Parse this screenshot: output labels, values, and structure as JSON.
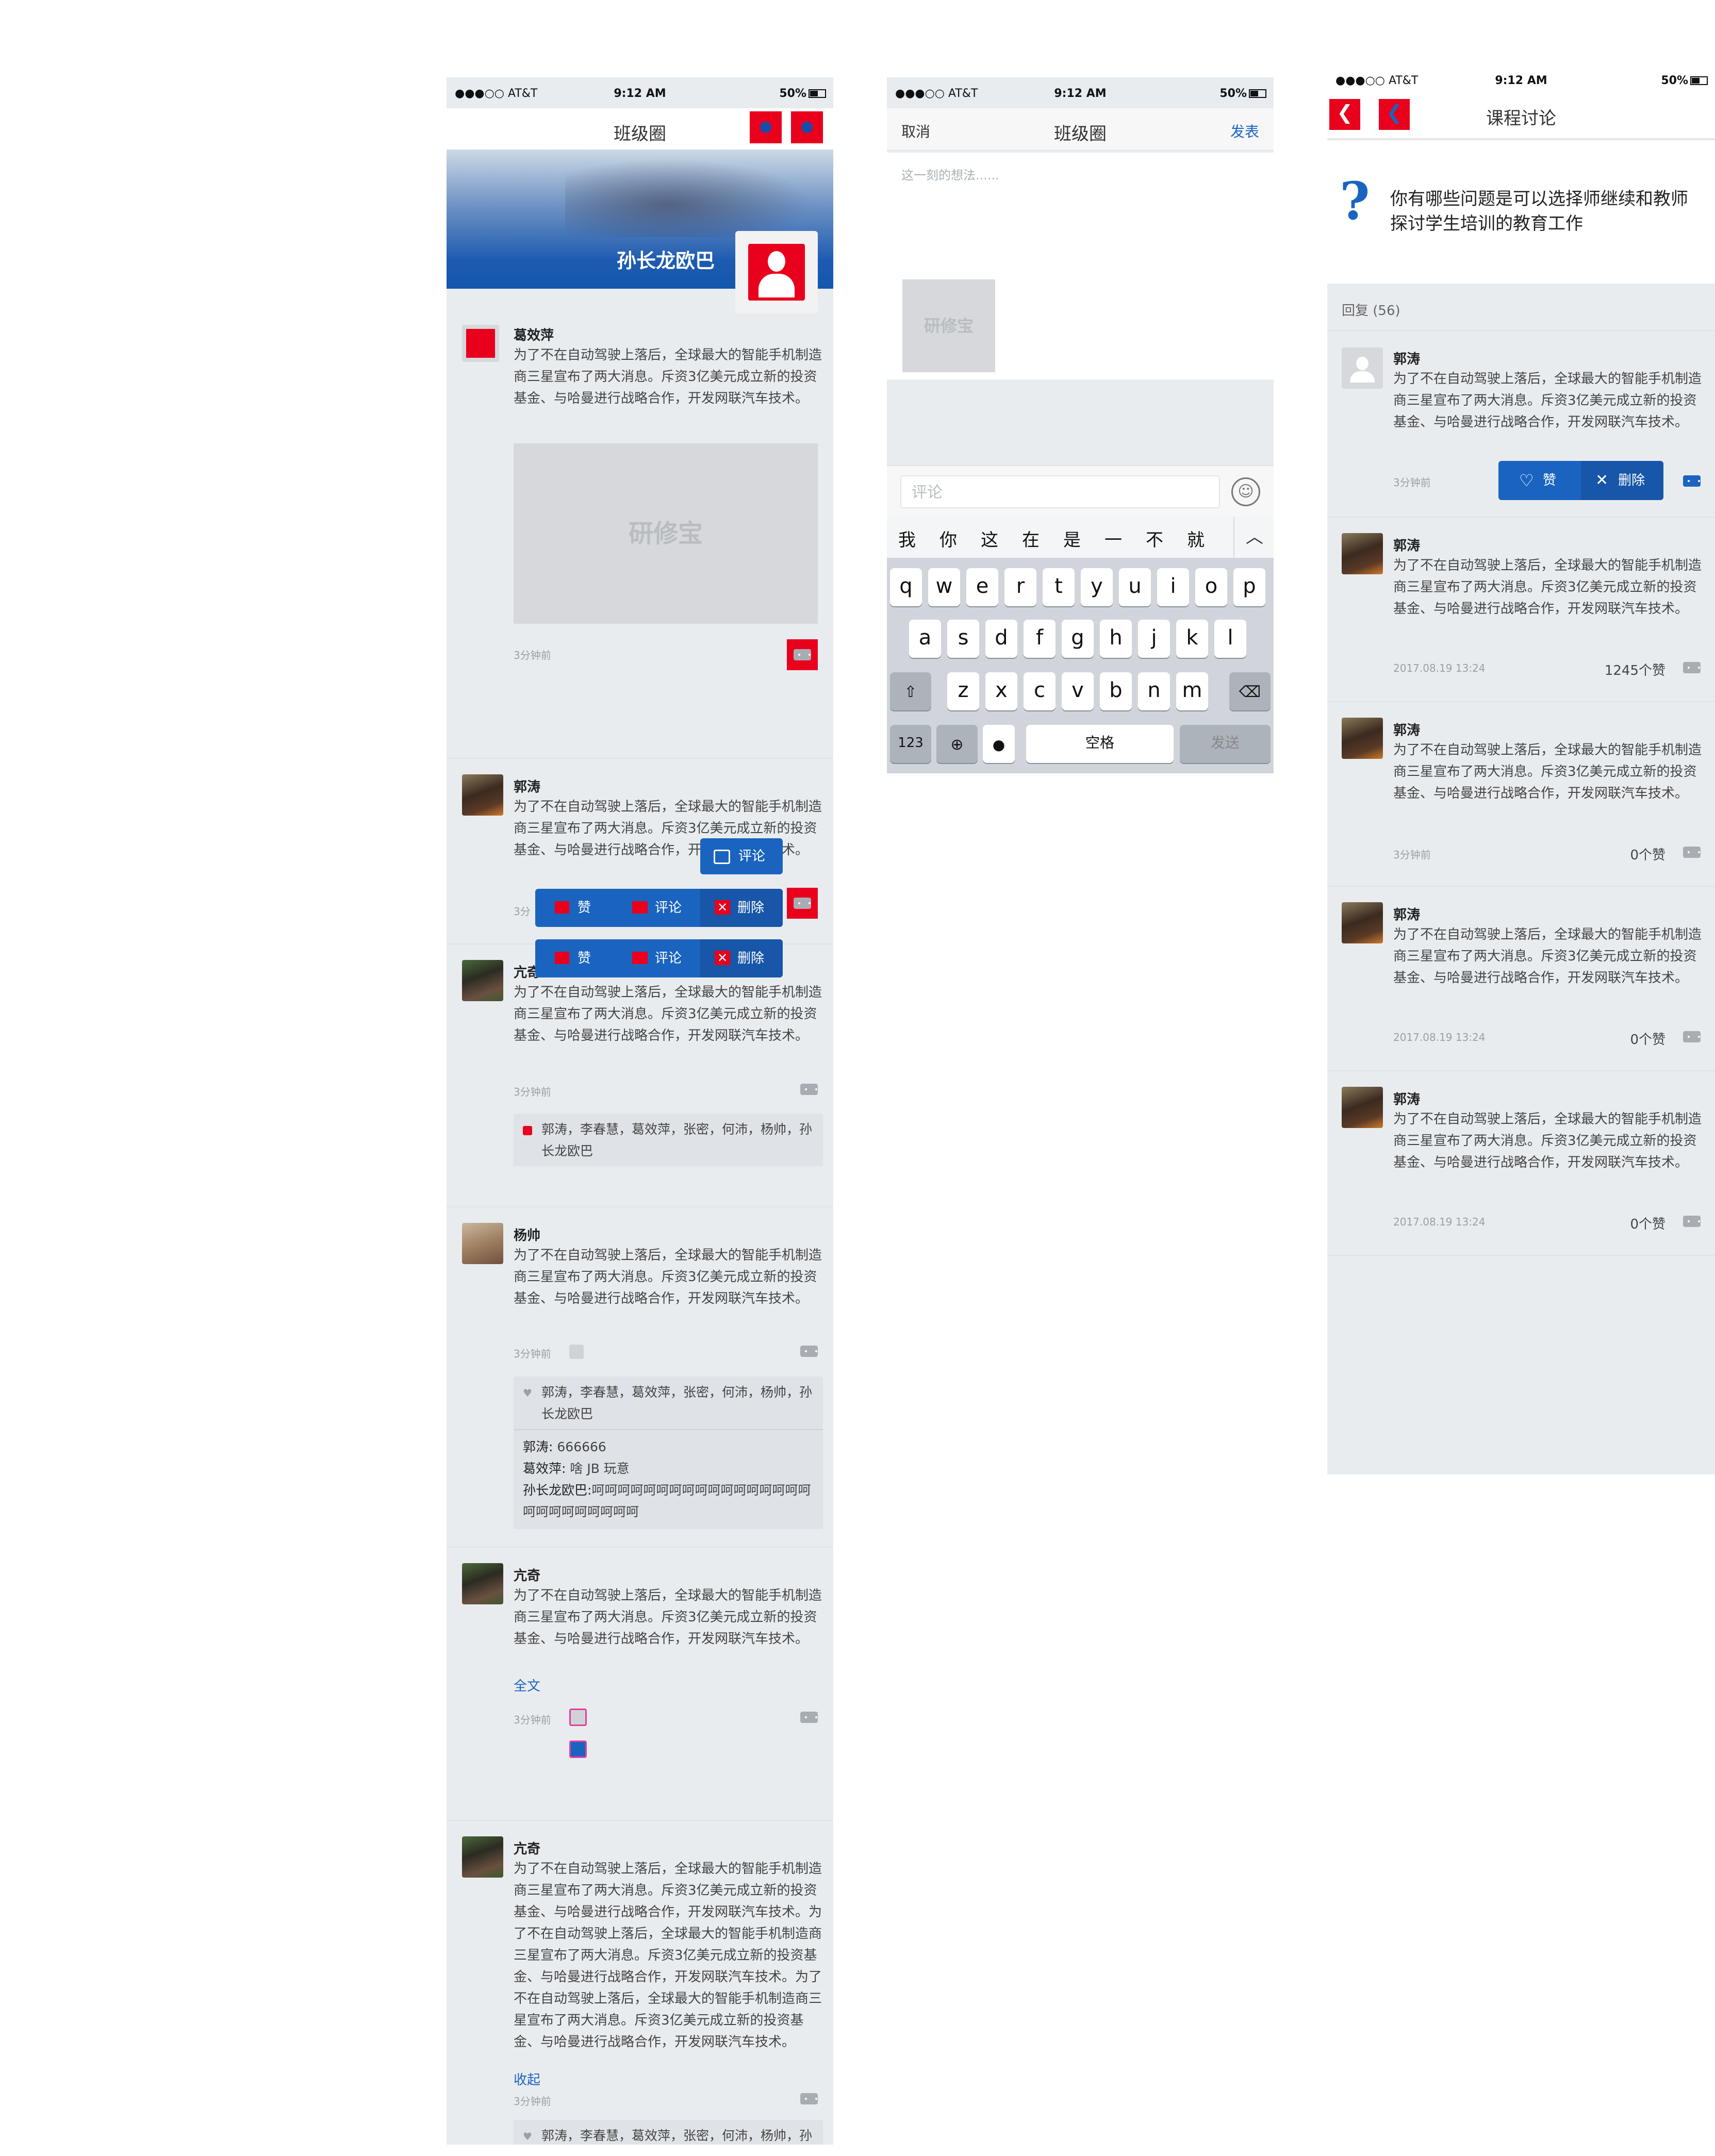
{
  "status": {
    "carrier": "●●●○○ AT&T",
    "time": "9:12 AM",
    "battery": "50%"
  },
  "screen1": {
    "title": "班级圈",
    "banner_name": "孙长龙欧巴",
    "image_placeholder": "研修宝",
    "posts": [
      {
        "user": "葛效萍",
        "text": "为了不在自动驾驶上落后，全球最大的智能手机制造商三星宣布了两大消息。斥资3亿美元成立新的投资基金、与哈曼进行战略合作，开发网联汽车技术。",
        "time": "3分钟前"
      },
      {
        "user": "郭涛",
        "text": "为了不在自动驾驶上落后，全球最大的智能手机制造商三星宣布了两大消息。斥资3亿美元成立新的投资基金、与哈曼进行战略合作，开发网联汽车技术。",
        "time": "3分"
      },
      {
        "user": "亢奇",
        "text": "为了不在自动驾驶上落后，全球最大的智能手机制造商三星宣布了两大消息。斥资3亿美元成立新的投资基金、与哈曼进行战略合作，开发网联汽车技术。",
        "time": "3分钟前",
        "likes": "郭涛，李春慧，葛效萍，张密，何沛，杨帅，孙长龙欧巴"
      },
      {
        "user": "杨帅",
        "text": "为了不在自动驾驶上落后，全球最大的智能手机制造商三星宣布了两大消息。斥资3亿美元成立新的投资基金、与哈曼进行战略合作，开发网联汽车技术。",
        "time": "3分钟前",
        "likes": "郭涛，李春慧，葛效萍，张密，何沛，杨帅，孙长龙欧巴",
        "comments": [
          {
            "who": "郭涛:",
            "text": "666666"
          },
          {
            "who": "葛效萍:",
            "text": "啥 JB 玩意"
          },
          {
            "who": "孙长龙欧巴:",
            "text": "呵呵呵呵呵呵呵呵呵呵呵呵呵呵呵呵呵呵呵呵呵呵呵呵呵呵"
          }
        ]
      },
      {
        "user": "亢奇",
        "text": "为了不在自动驾驶上落后，全球最大的智能手机制造商三星宣布了两大消息。斥资3亿美元成立新的投资基金、与哈曼进行战略合作，开发网联汽车技术。",
        "time": "3分钟前",
        "toggle": "全文"
      },
      {
        "user": "亢奇",
        "text": "为了不在自动驾驶上落后，全球最大的智能手机制造商三星宣布了两大消息。斥资3亿美元成立新的投资基金、与哈曼进行战略合作，开发网联汽车技术。为了不在自动驾驶上落后，全球最大的智能手机制造商三星宣布了两大消息。斥资3亿美元成立新的投资基金、与哈曼进行战略合作，开发网联汽车技术。为了不在自动驾驶上落后，全球最大的智能手机制造商三星宣布了两大消息。斥资3亿美元成立新的投资基金、与哈曼进行战略合作，开发网联汽车技术。",
        "time": "3分钟前",
        "toggle": "收起",
        "likes": "郭涛，李春慧，葛效萍，张密，何沛，杨帅，孙长龙欧巴"
      }
    ],
    "popup_comment": "评论",
    "actions": {
      "like": "赞",
      "comment": "评论",
      "delete": "删除"
    }
  },
  "screen2": {
    "cancel": "取消",
    "title": "班级圈",
    "publish": "发表",
    "placeholder": "这一刻的想法......",
    "image_placeholder": "研修宝",
    "comment_placeholder": "评论",
    "candidates": [
      "我",
      "你",
      "这",
      "在",
      "是",
      "一",
      "不",
      "就"
    ],
    "row1": [
      "q",
      "w",
      "e",
      "r",
      "t",
      "y",
      "u",
      "i",
      "o",
      "p"
    ],
    "row2": [
      "a",
      "s",
      "d",
      "f",
      "g",
      "h",
      "j",
      "k",
      "l"
    ],
    "row3": [
      "z",
      "x",
      "c",
      "v",
      "b",
      "n",
      "m"
    ],
    "num_key": "123",
    "space_key": "空格",
    "send_key": "发送"
  },
  "screen3": {
    "title": "课程讨论",
    "question": "你有哪些问题是可以选择师继续和教师探讨学生培训的教育工作",
    "reply_count": "回复 (56)",
    "actions": {
      "like": "赞",
      "delete": "删除"
    },
    "replies": [
      {
        "user": "郭涛",
        "text": "为了不在自动驾驶上落后，全球最大的智能手机制造商三星宣布了两大消息。斥资3亿美元成立新的投资基金、与哈曼进行战略合作，开发网联汽车技术。",
        "time": "3分钟前",
        "likes": ""
      },
      {
        "user": "郭涛",
        "text": "为了不在自动驾驶上落后，全球最大的智能手机制造商三星宣布了两大消息。斥资3亿美元成立新的投资基金、与哈曼进行战略合作，开发网联汽车技术。",
        "time": "2017.08.19 13:24",
        "likes": "1245个赞"
      },
      {
        "user": "郭涛",
        "text": "为了不在自动驾驶上落后，全球最大的智能手机制造商三星宣布了两大消息。斥资3亿美元成立新的投资基金、与哈曼进行战略合作，开发网联汽车技术。",
        "time": "3分钟前",
        "likes": "0个赞"
      },
      {
        "user": "郭涛",
        "text": "为了不在自动驾驶上落后，全球最大的智能手机制造商三星宣布了两大消息。斥资3亿美元成立新的投资基金、与哈曼进行战略合作，开发网联汽车技术。",
        "time": "2017.08.19 13:24",
        "likes": "0个赞"
      },
      {
        "user": "郭涛",
        "text": "为了不在自动驾驶上落后，全球最大的智能手机制造商三星宣布了两大消息。斥资3亿美元成立新的投资基金、与哈曼进行战略合作，开发网联汽车技术。",
        "time": "2017.08.19 13:24",
        "likes": "0个赞"
      }
    ]
  },
  "colors": {
    "accent_blue": "#1a64c0",
    "marker_red": "#e8001c",
    "bg_gray": "#e9ecef"
  }
}
